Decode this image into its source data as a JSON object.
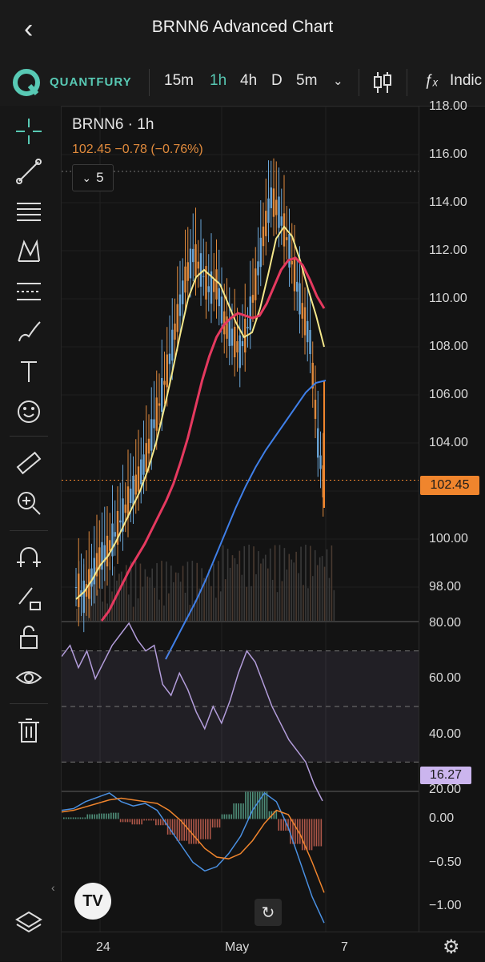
{
  "header": {
    "back_icon": "chevron-left-icon",
    "title": "BRNN6 Advanced Chart"
  },
  "toolbar": {
    "brand": "QUANTFURY",
    "timeframes": [
      "15m",
      "1h",
      "4h",
      "D",
      "5m"
    ],
    "active_timeframe": "1h",
    "dropdown_icon": "chevron-down-icon",
    "candles_icon": "candlestick-icon",
    "indicators_label": "Indic"
  },
  "left_tools": [
    "crosshair-icon",
    "trendline-icon",
    "horizontal-lines-icon",
    "pattern-icon",
    "fib-icon",
    "brush-icon",
    "text-icon",
    "emoji-icon",
    "ruler-icon",
    "zoom-in-icon",
    "magnet-icon",
    "lock-drawing-icon",
    "unlock-icon",
    "eye-icon",
    "trash-icon",
    "layers-icon"
  ],
  "legend": {
    "symbol": "BRNN6 · 1h",
    "quote": "102.45  −0.78 (−0.76%)",
    "collapse_count": "5"
  },
  "price_axis": [
    "118.00",
    "116.00",
    "114.00",
    "112.00",
    "110.00",
    "108.00",
    "106.00",
    "104.00",
    "102.00",
    "100.00",
    "98.00"
  ],
  "last_price": "102.45",
  "rsi_axis": [
    "80.00",
    "60.00",
    "40.00",
    "20.00"
  ],
  "rsi_value": "16.27",
  "macd_axis": [
    "0.00",
    "−0.50",
    "−1.00"
  ],
  "time_axis": [
    "24",
    "May",
    "7"
  ],
  "colors": {
    "accent": "#58c9b4",
    "price": "#f0852d",
    "rsi": "#b39ddb",
    "ma_fast": "#f4e78a",
    "ma_mid": "#e5395f",
    "ma_slow": "#3f7fe8"
  },
  "chart_data": {
    "type": "line",
    "symbol": "BRNN6",
    "series": [
      {
        "values": [
          98.0,
          97.6,
          98.4,
          99.2,
          99.5,
          100.2,
          101.0,
          101.8,
          102.5,
          103.4,
          104.8,
          106.0,
          107.5,
          109.2,
          110.8,
          111.8,
          111.2,
          110.4,
          110.6,
          109.0,
          108.4,
          107.8,
          108.8,
          110.6,
          112.6,
          114.2,
          113.6,
          112.5,
          111.0,
          109.5,
          108.2,
          104.0,
          101.6
        ]
      },
      {
        "values": [
          97.5,
          97.8,
          98.3,
          98.9,
          99.3,
          99.9,
          100.6,
          101.3,
          102.0,
          102.9,
          104.0,
          105.4,
          106.9,
          108.5,
          110.0,
          110.9,
          111.2,
          110.9,
          110.6,
          109.8,
          109.0,
          108.4,
          108.6,
          109.6,
          111.0,
          112.5,
          113.0,
          112.6,
          111.6,
          110.4,
          109.3,
          108.0
        ]
      },
      {
        "values": [
          96.6,
          97.0,
          97.6,
          98.2,
          98.8,
          99.3,
          99.8,
          100.4,
          101.0,
          101.6,
          102.3,
          103.2,
          104.2,
          105.4,
          106.6,
          107.6,
          108.4,
          108.9,
          109.2,
          109.4,
          109.3,
          109.2,
          109.3,
          109.8,
          110.5,
          111.2,
          111.6,
          111.7,
          111.4,
          110.8,
          110.1,
          109.6
        ]
      },
      {
        "values": [
          95.0,
          95.8,
          96.6,
          97.4,
          98.3,
          99.3,
          100.3,
          101.3,
          102.2,
          103.0,
          103.7,
          104.3,
          104.9,
          105.5,
          106.1,
          106.5,
          106.6
        ]
      }
    ],
    "rsi": [
      68,
      72,
      64,
      70,
      60,
      66,
      72,
      76,
      80,
      74,
      70,
      72,
      58,
      54,
      62,
      56,
      48,
      42,
      50,
      44,
      52,
      62,
      70,
      66,
      58,
      50,
      44,
      38,
      34,
      30,
      22,
      16
    ],
    "macd": [
      0.1,
      0.12,
      0.2,
      0.25,
      0.3,
      0.2,
      0.15,
      0.18,
      0.1,
      -0.1,
      -0.3,
      -0.5,
      -0.6,
      -0.55,
      -0.4,
      -0.2,
      0.1,
      0.3,
      0.2,
      -0.1,
      -0.5,
      -0.9,
      -1.2
    ],
    "macd_signal": [
      0.08,
      0.1,
      0.14,
      0.18,
      0.22,
      0.24,
      0.22,
      0.2,
      0.18,
      0.1,
      -0.02,
      -0.18,
      -0.34,
      -0.44,
      -0.46,
      -0.4,
      -0.25,
      -0.05,
      0.1,
      0.05,
      -0.18,
      -0.5,
      -0.85
    ],
    "ylim": [
      96.6,
      118.0
    ],
    "rsi_range": [
      80,
      20
    ],
    "rsi_bands": [
      70,
      50,
      30
    ],
    "macd_range": [
      0.3,
      -1.3
    ],
    "last_price": 102.45,
    "grid": true
  }
}
